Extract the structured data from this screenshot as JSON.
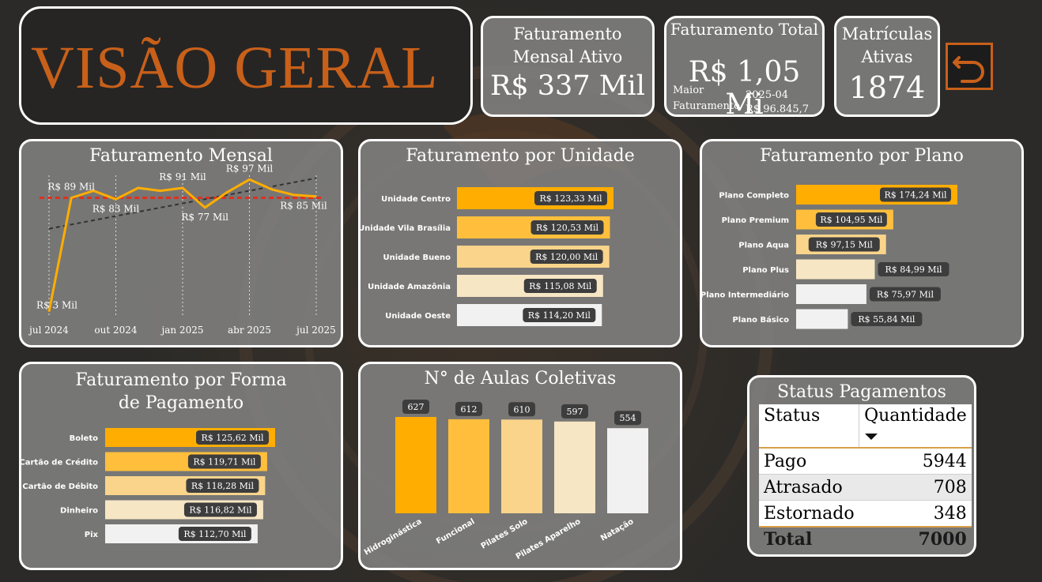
{
  "header": {
    "title": "VISÃO GERAL"
  },
  "kpis": {
    "mensal": {
      "label_line1": "Faturamento",
      "label_line2": "Mensal Ativo",
      "value": "R$ 337 Mil"
    },
    "total": {
      "label": "Faturamento Total",
      "value": "R$ 1,05 Mi",
      "sub_label_1": "Maior",
      "sub_label_2": "Faturamento",
      "sub_period": "2025-04",
      "sub_value": "R$ 96.845,7"
    },
    "matriculas": {
      "label_line1": "Matrículas",
      "label_line2": "Ativas",
      "value": "1874"
    }
  },
  "status_table": {
    "title": "Status Pagamentos",
    "col_status": "Status",
    "col_qty": "Quantidade",
    "rows": [
      {
        "status": "Pago",
        "qty": "5944"
      },
      {
        "status": "Atrasado",
        "qty": "708"
      },
      {
        "status": "Estornado",
        "qty": "348"
      }
    ],
    "total_label": "Total",
    "total_value": "7000"
  },
  "colors": {
    "accent": "#c8601a",
    "bar_top": "#ffad00",
    "bar_2": "#ffbf3c",
    "bar_3": "#f9d48a",
    "bar_4": "#f7e6c4",
    "bar_5": "#f1f1f1",
    "line": "#ffad00",
    "avg_line": "#e0301e",
    "trend": "#333333"
  },
  "chart_data": [
    {
      "id": "mensal",
      "type": "line",
      "title": "Faturamento Mensal",
      "x": [
        "2024-07",
        "2024-08",
        "2024-09",
        "2024-10",
        "2024-11",
        "2024-12",
        "2025-01",
        "2025-02",
        "2025-03",
        "2025-04",
        "2025-05",
        "2025-06",
        "2025-07"
      ],
      "x_ticks": [
        {
          "at": "2024-07",
          "label": "jul 2024"
        },
        {
          "at": "2024-10",
          "label": "out 2024"
        },
        {
          "at": "2025-01",
          "label": "jan 2025"
        },
        {
          "at": "2025-04",
          "label": "abr 2025"
        },
        {
          "at": "2025-07",
          "label": "jul 2025"
        }
      ],
      "values": [
        3,
        84,
        89,
        83,
        91,
        89,
        91,
        77,
        88,
        97,
        90,
        86,
        85
      ],
      "data_labels": [
        {
          "at": "2024-07",
          "text": "R$ 3 Mil"
        },
        {
          "at": "2024-08",
          "text": "R$ 89 Mil"
        },
        {
          "at": "2024-10",
          "text": "R$ 83 Mil"
        },
        {
          "at": "2025-01",
          "text": "R$ 91 Mil"
        },
        {
          "at": "2025-02",
          "text": "R$ 77 Mil"
        },
        {
          "at": "2025-04",
          "text": "R$ 97 Mil"
        },
        {
          "at": "2025-07",
          "text": "R$ 85 Mil"
        }
      ],
      "average": 84,
      "trend": [
        62,
        98
      ],
      "ylim": [
        0,
        100
      ]
    },
    {
      "id": "unidade",
      "type": "bar",
      "orientation": "horizontal",
      "title": "Faturamento por Unidade",
      "categories": [
        "Unidade Centro",
        "Unidade Vila Brasília",
        "Unidade Bueno",
        "Unidade Amazônia",
        "Unidade Oeste"
      ],
      "values": [
        123.33,
        120.53,
        120.0,
        115.08,
        114.2
      ],
      "labels": [
        "R$ 123,33 Mil",
        "R$ 120,53 Mil",
        "R$ 120,00 Mil",
        "R$ 115,08 Mil",
        "R$ 114,20 Mil"
      ]
    },
    {
      "id": "plano",
      "type": "bar",
      "orientation": "horizontal",
      "title": "Faturamento por Plano",
      "categories": [
        "Plano Completo",
        "Plano Premium",
        "Plano Aqua",
        "Plano Plus",
        "Plano Intermediário",
        "Plano Básico"
      ],
      "values": [
        174.24,
        104.95,
        97.15,
        84.99,
        75.97,
        55.84
      ],
      "labels": [
        "R$ 174,24 Mil",
        "R$ 104,95 Mil",
        "R$ 97,15 Mil",
        "R$ 84,99 Mil",
        "R$ 75,97 Mil",
        "R$ 55,84 Mil"
      ]
    },
    {
      "id": "pagamento",
      "type": "bar",
      "orientation": "horizontal",
      "title": "Faturamento por Forma de Pagamento",
      "categories": [
        "Boleto",
        "Cartão de Crédito",
        "Cartão de Débito",
        "Dinheiro",
        "Pix"
      ],
      "values": [
        125.62,
        119.71,
        118.28,
        116.82,
        112.7
      ],
      "labels": [
        "R$ 125,62 Mil",
        "R$ 119,71 Mil",
        "R$ 118,28 Mil",
        "R$ 116,82 Mil",
        "R$ 112,70 Mil"
      ]
    },
    {
      "id": "aulas",
      "type": "bar",
      "orientation": "vertical",
      "title": "N° de Aulas Coletivas",
      "categories": [
        "Hidroginástica",
        "Funcional",
        "Pilates Solo",
        "Pilates Aparelho",
        "Natação"
      ],
      "values": [
        627,
        612,
        610,
        597,
        554
      ],
      "labels": [
        "627",
        "612",
        "610",
        "597",
        "554"
      ]
    }
  ]
}
